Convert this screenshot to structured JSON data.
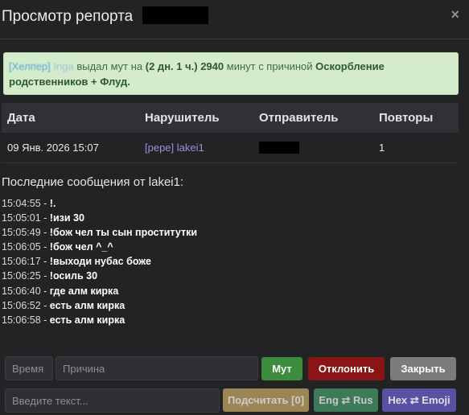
{
  "header": {
    "title": "Просмотр репорта",
    "close_symbol": "×"
  },
  "alert": {
    "tag": "[Хелпер]",
    "name": "Inga",
    "text1": " выдал мут на ",
    "duration": "(2 дн. 1 ч.) 2940",
    "text2": " минут с причиной ",
    "reason": "Оскорбление родственников + Флуд."
  },
  "table": {
    "headers": [
      "Дата",
      "Нарушитель",
      "Отправитель",
      "Повторы"
    ],
    "row": {
      "date": "09 Янв. 2026 15:07",
      "offender": "[pepe] lakei1",
      "repeats": "1"
    }
  },
  "messages_title": "Последние сообщения от lakei1:",
  "messages": [
    {
      "time": "15:04:55",
      "text": "!."
    },
    {
      "time": "15:05:01",
      "text": "!изи 30"
    },
    {
      "time": "15:05:49",
      "text": "!бож чел ты сын проститутки"
    },
    {
      "time": "15:06:05",
      "text": "!бож чел ^_^"
    },
    {
      "time": "15:06:17",
      "text": "!выходи нубас боже"
    },
    {
      "time": "15:06:25",
      "text": "!осиль 30"
    },
    {
      "time": "15:06:40",
      "text": "где алм кирка"
    },
    {
      "time": "15:06:52",
      "text": "есть алм кирка"
    },
    {
      "time": "15:06:58",
      "text": "есть алм кирка"
    }
  ],
  "form": {
    "time_placeholder": "Время",
    "reason_placeholder": "Причина",
    "mute_label": "Мут",
    "decline_label": "Отклонить",
    "close_label": "Закрыть",
    "text_placeholder": "Введите текст...",
    "count_label": "Подсчитать [0]",
    "layout_label": "Eng ⇄ Rus",
    "hex_label": "Hex ⇄ Emoji"
  },
  "colors": {
    "background": "#222325",
    "alert_bg": "#d4eccc",
    "mute": "#3d8b3d",
    "decline": "#8a1515",
    "close": "#7a7b7d",
    "count": "#9c8554",
    "layout": "#3d7a57",
    "hex": "#5752a4",
    "offender": "#a58be0"
  }
}
